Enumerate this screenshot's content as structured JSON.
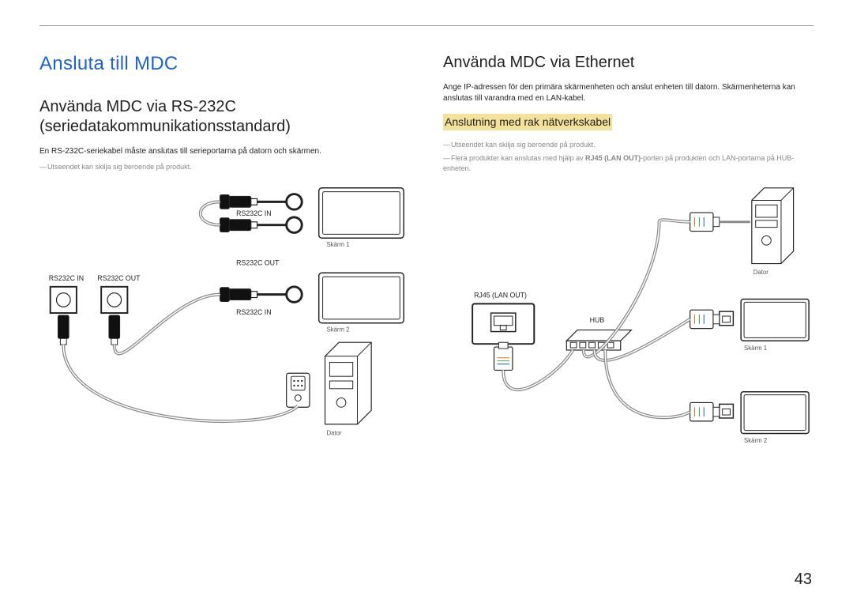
{
  "mainTitle": "Ansluta till MDC",
  "pageNumber": "43",
  "left": {
    "heading": "Använda MDC via RS-232C (seriedatakommunikationsstandard)",
    "body": "En RS-232C-seriekabel måste anslutas till serieportarna på datorn och skärmen.",
    "note1": "Utseendet kan skilja sig beroende på produkt.",
    "diagram": {
      "rs232cIn": "RS232C IN",
      "rs232cOut": "RS232C OUT",
      "rs232cIn2": "RS232C IN",
      "rs232cInPort": "RS232C IN",
      "rs232cOutPort": "RS232C OUT",
      "skarm1": "Skärm 1",
      "skarm2": "Skärm 2",
      "dator": "Dator"
    }
  },
  "right": {
    "heading": "Använda MDC via Ethernet",
    "body": "Ange IP-adressen för den primära skärmenheten och anslut enheten till datorn. Skärmenheterna kan anslutas till varandra med en LAN-kabel.",
    "subheading": "Anslutning med rak nätverkskabel",
    "note1": "Utseendet kan skilja sig beroende på produkt.",
    "note2a": "Flera produkter kan anslutas med hjälp av ",
    "note2bold": "RJ45 (LAN OUT)",
    "note2b": "-porten på produkten och LAN-portarna på HUB-enheten.",
    "diagram": {
      "rj45": "RJ45 (LAN OUT)",
      "hub": "HUB",
      "dator": "Dator",
      "skarm1": "Skärm 1",
      "skarm2": "Skärm 2"
    }
  }
}
